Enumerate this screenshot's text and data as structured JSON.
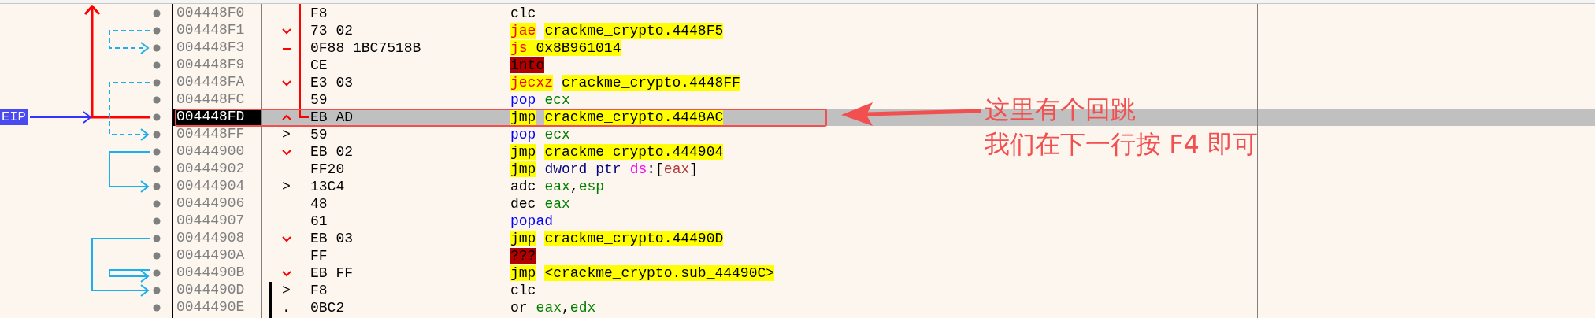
{
  "eip_label": "EIP",
  "rows": [
    {
      "address": "004448F0",
      "bytes": "F8",
      "selected": false,
      "instruction": [
        {
          "text": "clc",
          "kind": "plain"
        }
      ]
    },
    {
      "address": "004448F1",
      "marker": {
        "kind": "down"
      },
      "bytes": "73 02",
      "selected": false,
      "instruction": [
        {
          "text": "jae",
          "kind": "jcc"
        },
        {
          "text": "crackme_crypto.4448F5",
          "kind": "target",
          "spaced": true
        }
      ]
    },
    {
      "address": "004448F3",
      "marker": {
        "kind": "dash"
      },
      "bytes": "0F88 1BC7518B",
      "selected": false,
      "instruction": [
        {
          "text": "js",
          "kind": "jcc"
        },
        {
          "text": " 0x8B961014",
          "kind": "target"
        }
      ]
    },
    {
      "address": "004448F9",
      "bytes": "CE",
      "selected": false,
      "instruction": [
        {
          "text": "into",
          "kind": "invalid"
        }
      ]
    },
    {
      "address": "004448FA",
      "marker": {
        "kind": "down"
      },
      "bytes": "E3 03",
      "selected": false,
      "instruction": [
        {
          "text": "jecxz",
          "kind": "jcc"
        },
        {
          "text": "crackme_crypto.4448FF",
          "kind": "target",
          "spaced": true
        }
      ]
    },
    {
      "address": "004448FC",
      "bytes": "59",
      "selected": false,
      "instruction": [
        {
          "text": "pop",
          "kind": "stack"
        },
        {
          "text": "ecx",
          "kind": "reg",
          "spaced": true
        }
      ]
    },
    {
      "address": "004448FD",
      "marker": {
        "kind": "up"
      },
      "bytes": "EB AD",
      "selected": true,
      "instruction": [
        {
          "text": "jmp",
          "kind": "jmp"
        },
        {
          "text": "crackme_crypto.4448AC",
          "kind": "target",
          "spaced": true
        }
      ]
    },
    {
      "address": "004448FF",
      "marker": {
        "kind": "text",
        "text": ">"
      },
      "bytes": "59",
      "selected": false,
      "instruction": [
        {
          "text": "pop",
          "kind": "stack"
        },
        {
          "text": "ecx",
          "kind": "reg",
          "spaced": true
        }
      ]
    },
    {
      "address": "00444900",
      "marker": {
        "kind": "down"
      },
      "bytes": "EB 02",
      "selected": false,
      "instruction": [
        {
          "text": "jmp",
          "kind": "jmp"
        },
        {
          "text": "crackme_crypto.444904",
          "kind": "target",
          "spaced": true
        }
      ]
    },
    {
      "address": "00444902",
      "bytes": "FF20",
      "selected": false,
      "instruction": [
        {
          "text": "jmp",
          "kind": "jmp"
        },
        {
          "text": "dword ptr",
          "kind": "size",
          "spaced": true
        },
        {
          "text": "ds",
          "kind": "seg",
          "spaced": true
        },
        {
          "text": ":[",
          "kind": "plain"
        },
        {
          "text": "eax",
          "kind": "memreg"
        },
        {
          "text": "]",
          "kind": "plain"
        }
      ]
    },
    {
      "address": "00444904",
      "marker": {
        "kind": "text",
        "text": ">"
      },
      "bytes": "13C4",
      "selected": false,
      "instruction": [
        {
          "text": "adc",
          "kind": "plain"
        },
        {
          "text": "eax",
          "kind": "reg",
          "spaced": true
        },
        {
          "text": ",",
          "kind": "plain"
        },
        {
          "text": "esp",
          "kind": "reg"
        }
      ]
    },
    {
      "address": "00444906",
      "bytes": "48",
      "selected": false,
      "instruction": [
        {
          "text": "dec",
          "kind": "plain"
        },
        {
          "text": "eax",
          "kind": "reg",
          "spaced": true
        }
      ]
    },
    {
      "address": "00444907",
      "bytes": "61",
      "selected": false,
      "instruction": [
        {
          "text": "popad",
          "kind": "stack"
        }
      ]
    },
    {
      "address": "00444908",
      "marker": {
        "kind": "down"
      },
      "bytes": "EB 03",
      "selected": false,
      "instruction": [
        {
          "text": "jmp",
          "kind": "jmp"
        },
        {
          "text": "crackme_crypto.44490D",
          "kind": "target",
          "spaced": true
        }
      ]
    },
    {
      "address": "0044490A",
      "bytes": "FF",
      "selected": false,
      "instruction": [
        {
          "text": "???",
          "kind": "invalid"
        }
      ]
    },
    {
      "address": "0044490B",
      "marker": {
        "kind": "down"
      },
      "bytes": "EB FF",
      "selected": false,
      "instruction": [
        {
          "text": "jmp",
          "kind": "jmp"
        },
        {
          "text": "<crackme_crypto.sub_44490C>",
          "kind": "target",
          "spaced": true
        }
      ]
    },
    {
      "address": "0044490D",
      "marker": {
        "kind": "text",
        "text": ">"
      },
      "bytes": "F8",
      "selected": false,
      "instruction": [
        {
          "text": "clc",
          "kind": "plain"
        }
      ]
    },
    {
      "address": "0044490E",
      "marker": {
        "kind": "text",
        "text": "."
      },
      "bytes": "0BC2",
      "selected": false,
      "instruction": [
        {
          "text": "or",
          "kind": "plain"
        },
        {
          "text": "eax",
          "kind": "reg",
          "spaced": true
        },
        {
          "text": ",",
          "kind": "plain"
        },
        {
          "text": "edx",
          "kind": "reg"
        }
      ]
    }
  ],
  "annotation": {
    "lines": [
      "这里有个回跳",
      "我们在下一行按 F4 即可"
    ]
  }
}
